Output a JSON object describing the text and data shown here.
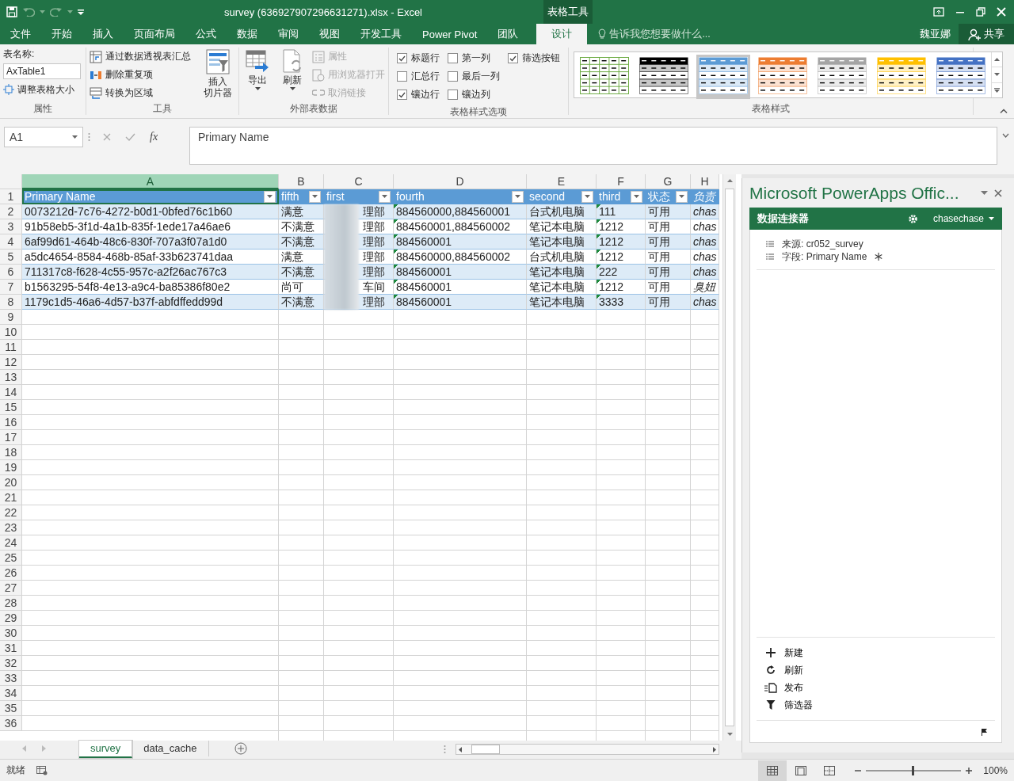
{
  "window": {
    "title": "survey (636927907296631271).xlsx - Excel",
    "contextual_tab_group": "表格工具",
    "user": "魏亚娜",
    "share": "共享",
    "tell_me": {
      "placeholder": "告诉我您想要做什么..."
    }
  },
  "ribbon_tabs": [
    {
      "label": "文件",
      "selected": false
    },
    {
      "label": "开始",
      "selected": false
    },
    {
      "label": "插入",
      "selected": false
    },
    {
      "label": "页面布局",
      "selected": false
    },
    {
      "label": "公式",
      "selected": false
    },
    {
      "label": "数据",
      "selected": false
    },
    {
      "label": "审阅",
      "selected": false
    },
    {
      "label": "视图",
      "selected": false
    },
    {
      "label": "开发工具",
      "selected": false
    },
    {
      "label": "Power Pivot",
      "selected": false
    },
    {
      "label": "团队",
      "selected": false
    },
    {
      "label": "设计",
      "selected": true
    }
  ],
  "properties_group": {
    "label": "属性",
    "name_label": "表名称:",
    "table_name": "AxTable1",
    "resize": "调整表格大小"
  },
  "tools_group": {
    "label": "工具",
    "commands": [
      {
        "label": "通过数据透视表汇总",
        "kind": "pivot"
      },
      {
        "label": "删除重复项",
        "kind": "dedupe"
      },
      {
        "label": "转换为区域",
        "kind": "convert"
      }
    ],
    "slicer": [
      "插入",
      "切片器"
    ]
  },
  "external_group": {
    "label": "外部表数据",
    "export": "导出",
    "refresh": "刷新",
    "commands": [
      {
        "label": "属性",
        "kind": "properties",
        "disabled": true
      },
      {
        "label": "用浏览器打开",
        "kind": "browser",
        "disabled": true
      },
      {
        "label": "取消链接",
        "kind": "unlink",
        "disabled": true
      }
    ]
  },
  "style_options": {
    "label": "表格样式选项",
    "options": [
      {
        "label": "标题行",
        "checked": true
      },
      {
        "label": "汇总行",
        "checked": false
      },
      {
        "label": "镶边行",
        "checked": true
      },
      {
        "label": "第一列",
        "checked": false
      },
      {
        "label": "最后一列",
        "checked": false
      },
      {
        "label": "镶边列",
        "checked": false
      },
      {
        "label": "筛选按钮",
        "checked": true
      }
    ]
  },
  "table_styles": {
    "label": "表格样式",
    "styles": [
      {
        "kind": "grid",
        "color": "#70ad47",
        "selected": false
      },
      {
        "kind": "banded",
        "color": "#000000",
        "selected": false
      },
      {
        "kind": "banded",
        "color": "#5b9bd5",
        "selected": true
      },
      {
        "kind": "banded",
        "color": "#ed7d31",
        "selected": false
      },
      {
        "kind": "banded",
        "color": "#a5a5a5",
        "selected": false
      },
      {
        "kind": "banded",
        "color": "#ffc000",
        "selected": false
      },
      {
        "kind": "banded",
        "color": "#4472c4",
        "selected": false
      }
    ]
  },
  "formula_bar": {
    "name_box": "A1",
    "function_label": "fx",
    "value": "Primary Name"
  },
  "sheet": {
    "columns": [
      {
        "letter": "A",
        "header": "Primary Name",
        "selected": true,
        "filter": true,
        "error_marks": false,
        "italic": false
      },
      {
        "letter": "B",
        "header": "fifth",
        "selected": false,
        "filter": true,
        "error_marks": false,
        "italic": false
      },
      {
        "letter": "C",
        "header": "first",
        "selected": false,
        "filter": true,
        "error_marks": false,
        "italic": false
      },
      {
        "letter": "D",
        "header": "fourth",
        "selected": false,
        "filter": true,
        "error_marks": true,
        "italic": false
      },
      {
        "letter": "E",
        "header": "second",
        "selected": false,
        "filter": true,
        "error_marks": false,
        "italic": false
      },
      {
        "letter": "F",
        "header": "third",
        "selected": false,
        "filter": true,
        "error_marks": true,
        "italic": false
      },
      {
        "letter": "G",
        "header": "状态",
        "selected": false,
        "filter": true,
        "error_marks": false,
        "italic": false
      },
      {
        "letter": "H",
        "header": "负责",
        "selected": false,
        "filter": false,
        "error_marks": false,
        "italic": true
      }
    ],
    "rows": [
      [
        "0073212d-7c76-4272-b0d1-0bfed76c1b60",
        "满意",
        "理部",
        "884560000,884560001",
        "台式机电脑",
        "111",
        "可用",
        "chas"
      ],
      [
        "91b58eb5-3f1d-4a1b-835f-1ede17a46ae6",
        "不满意",
        "理部",
        "884560001,884560002",
        "笔记本电脑",
        "1212",
        "可用",
        "chas"
      ],
      [
        "6af99d61-464b-48c6-830f-707a3f07a1d0",
        "不满意",
        "理部",
        "884560001",
        "笔记本电脑",
        "1212",
        "可用",
        "chas"
      ],
      [
        "a5dc4654-8584-468b-85af-33b623741daa",
        "满意",
        "理部",
        "884560000,884560002",
        "台式机电脑",
        "1212",
        "可用",
        "chas"
      ],
      [
        "711317c8-f628-4c55-957c-a2f26ac767c3",
        "不满意",
        "理部",
        "884560001",
        "笔记本电脑",
        "222",
        "可用",
        "chas"
      ],
      [
        "b1563295-54f8-4e13-a9c4-ba85386f80e2",
        "尚可",
        "车间",
        "884560001",
        "笔记本电脑",
        "1212",
        "可用",
        "臭妞"
      ],
      [
        "1179c1d5-46a6-4d57-b37f-abfdffedd99d",
        "不满意",
        "理部",
        "884560001",
        "笔记本电脑",
        "3333",
        "可用",
        "chas"
      ]
    ],
    "row_numbers": [
      "1",
      "2",
      "3",
      "4",
      "5",
      "6",
      "7",
      "8",
      "9",
      "10",
      "11",
      "12",
      "13",
      "14",
      "15",
      "16",
      "17",
      "18",
      "19",
      "20",
      "21",
      "22",
      "23",
      "24",
      "25",
      "26",
      "27",
      "28",
      "29",
      "30",
      "31",
      "32",
      "33",
      "34",
      "35",
      "36"
    ]
  },
  "sheet_tabs": [
    {
      "label": "survey",
      "selected": true
    },
    {
      "label": "data_cache",
      "selected": false
    }
  ],
  "panel": {
    "title": "Microsoft PowerApps Offic...",
    "header": "数据连接器",
    "account": "chasechase",
    "info": [
      {
        "label": "来源: cr052_survey",
        "kind": "source"
      },
      {
        "label": "字段: Primary Name",
        "kind": "field"
      }
    ],
    "actions": [
      {
        "label": "新建",
        "kind": "new"
      },
      {
        "label": "刷新",
        "kind": "refresh"
      },
      {
        "label": "发布",
        "kind": "publish"
      },
      {
        "label": "筛选器",
        "kind": "filter"
      }
    ]
  },
  "status_bar": {
    "ready": "就绪",
    "zoom": "100%"
  }
}
